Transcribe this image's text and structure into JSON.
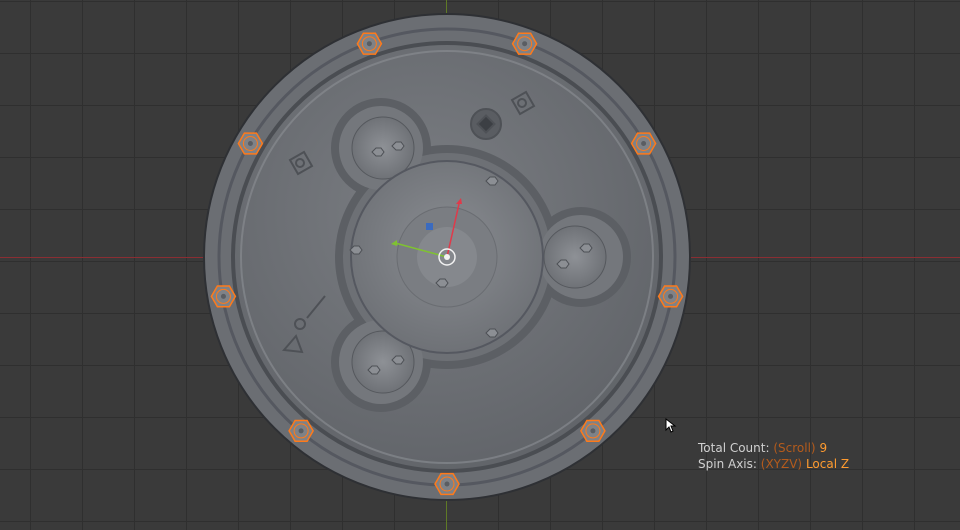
{
  "hud": {
    "total_count_label": "Total Count:",
    "total_count_hint": "(Scroll)",
    "total_count_value": "9",
    "spin_axis_label": "Spin Axis:",
    "spin_axis_hint": "(XYZV)",
    "spin_axis_value": "Local Z"
  },
  "viewport": {
    "background_color": "#3a3a3a",
    "x_axis_color": "#8a2e33",
    "y_axis_color": "#5f7a26",
    "selection_color": "#ff7a1a"
  },
  "icons": [
    "mouse-cursor-icon",
    "transform-gizmo-icon",
    "object-origin-icon"
  ]
}
